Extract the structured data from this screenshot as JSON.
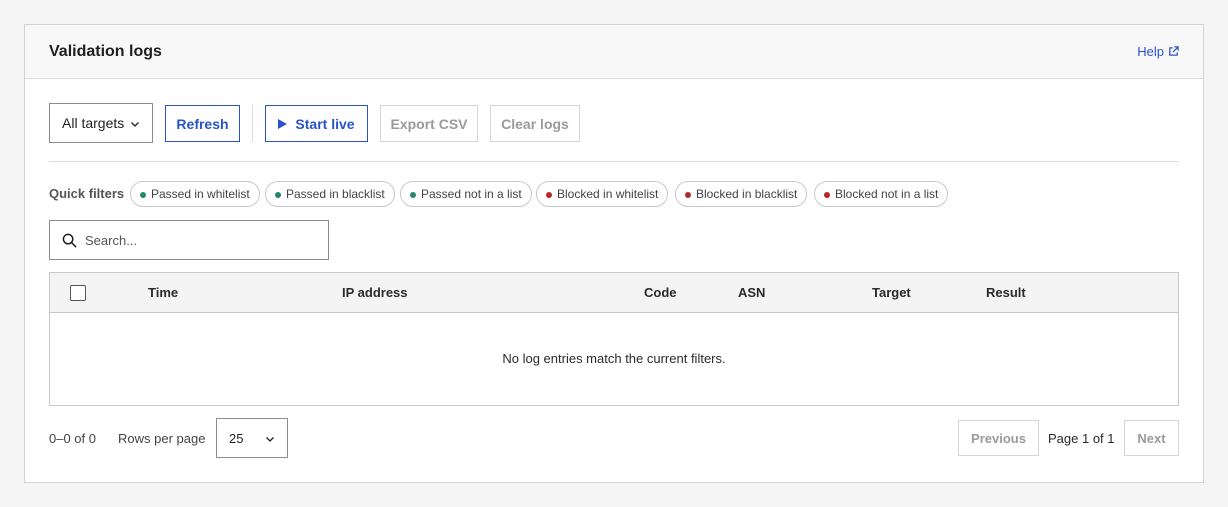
{
  "panel": {
    "title": "Validation logs",
    "help_label": "Help"
  },
  "toolbar": {
    "target_select_value": "All targets",
    "refresh_label": "Refresh",
    "start_live_label": "Start live",
    "export_label": "Export CSV",
    "clear_label": "Clear logs"
  },
  "quick_filters": {
    "label": "Quick filters",
    "chips": [
      {
        "label": "Passed in whitelist",
        "color": "#1f8a6e"
      },
      {
        "label": "Passed in blacklist",
        "color": "#1f8a6e"
      },
      {
        "label": "Passed not in a list",
        "color": "#1f8a6e"
      },
      {
        "label": "Blocked in whitelist",
        "color": "#b3262b"
      },
      {
        "label": "Blocked in blacklist",
        "color": "#b3262b"
      },
      {
        "label": "Blocked not in a list",
        "color": "#b3262b"
      }
    ]
  },
  "search": {
    "placeholder": "Search...",
    "value": ""
  },
  "table": {
    "columns": [
      "Time",
      "IP address",
      "Code",
      "ASN",
      "Target",
      "Result"
    ],
    "rows": [],
    "empty_message": "No log entries match the current filters."
  },
  "pagination": {
    "range_text": "0–0 of 0",
    "rows_per_page_label": "Rows per page",
    "rows_per_page_value": "25",
    "previous_label": "Previous",
    "page_text": "Page 1 of 1",
    "next_label": "Next"
  },
  "colors": {
    "accent": "#2b53c9",
    "passed": "#1f8a6e",
    "blocked": "#b3262b"
  }
}
